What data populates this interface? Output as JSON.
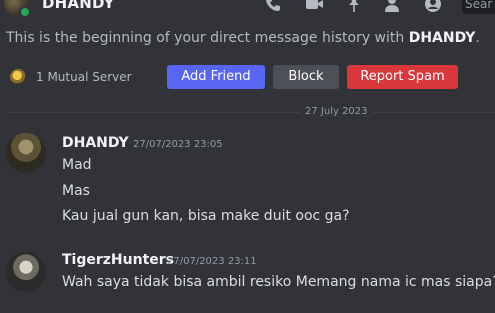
{
  "header": {
    "title": "DHANDY",
    "status_color": "#23a55a",
    "icons": [
      "call-icon",
      "video-call-icon",
      "pinned-messages-icon",
      "add-friends-to-dm-icon",
      "user-profile-icon"
    ],
    "search_placeholder": "Sear"
  },
  "intro": {
    "prefix": "This is the beginning of your direct message history with ",
    "name": "DHANDY",
    "suffix": "."
  },
  "mutual_servers": {
    "label": "1 Mutual Server"
  },
  "actions": {
    "add_friend": "Add Friend",
    "block": "Block",
    "report_spam": "Report Spam"
  },
  "date_divider": "27 July 2023",
  "messages": [
    {
      "author": "DHANDY",
      "timestamp": "27/07/2023 23:05",
      "lines": [
        "Mad",
        "Mas",
        "Kau jual gun kan, bisa make duit ooc ga?"
      ]
    },
    {
      "author": "TigerzHunters",
      "timestamp": "27/07/2023 23:11",
      "lines": [
        "Wah saya tidak bisa ambil resiko Memang nama ic mas siapa?"
      ]
    }
  ],
  "colors": {
    "background": "#313338",
    "add_friend": "#5865f2",
    "block": "#4e5058",
    "report_spam": "#da373c"
  }
}
